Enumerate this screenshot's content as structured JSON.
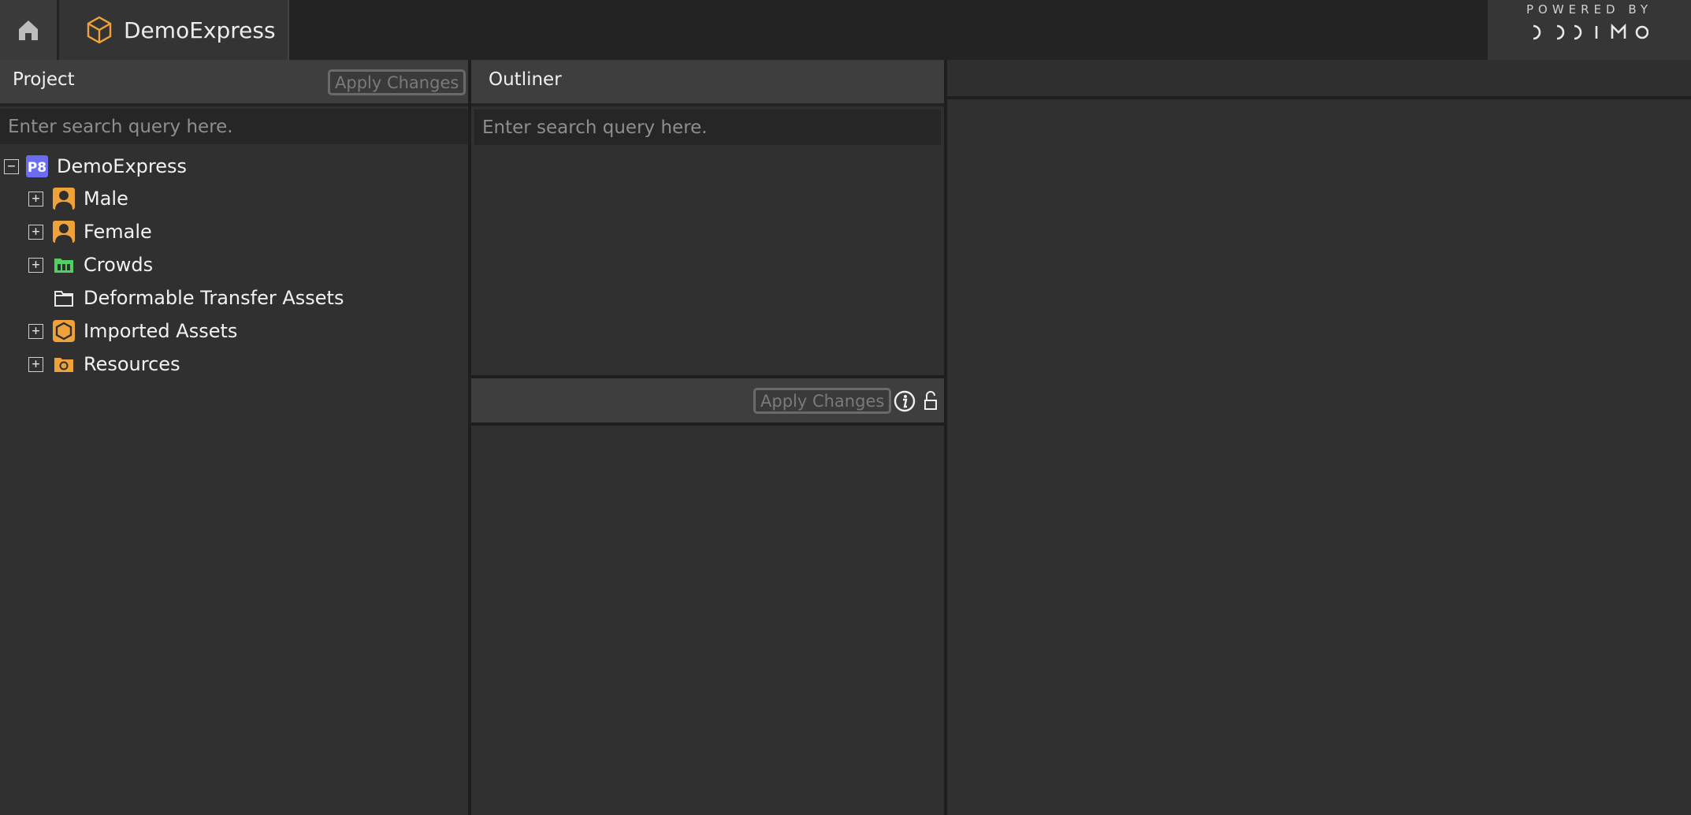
{
  "topbar": {
    "project_tab_label": "DemoExpress",
    "brand_powered": "POWERED BY",
    "brand_logo_icon": "didimo-logo-icon"
  },
  "project_panel": {
    "title": "Project",
    "apply_label": "Apply Changes",
    "search_placeholder": "Enter search query here.",
    "tree": [
      {
        "label": "DemoExpress",
        "icon": "p8-project-icon",
        "toggle": "−",
        "level": 0
      },
      {
        "label": "Male",
        "icon": "person-icon",
        "toggle": "+",
        "level": 1
      },
      {
        "label": "Female",
        "icon": "person-icon",
        "toggle": "+",
        "level": 1
      },
      {
        "label": "Crowds",
        "icon": "crowds-folder-icon",
        "toggle": "+",
        "level": 1
      },
      {
        "label": "Deformable Transfer Assets",
        "icon": "folder-icon",
        "toggle": "",
        "level": 1
      },
      {
        "label": "Imported Assets",
        "icon": "hexagon-icon",
        "toggle": "+",
        "level": 1
      },
      {
        "label": "Resources",
        "icon": "resources-folder-icon",
        "toggle": "+",
        "level": 1
      }
    ]
  },
  "outliner_panel": {
    "title": "Outliner",
    "search_placeholder": "Enter search query here."
  },
  "properties_panel": {
    "apply_label": "Apply Changes"
  },
  "colors": {
    "accent_orange": "#f0a23a",
    "p8_blue": "#6b6cf2",
    "crowds_green": "#4fd060"
  }
}
